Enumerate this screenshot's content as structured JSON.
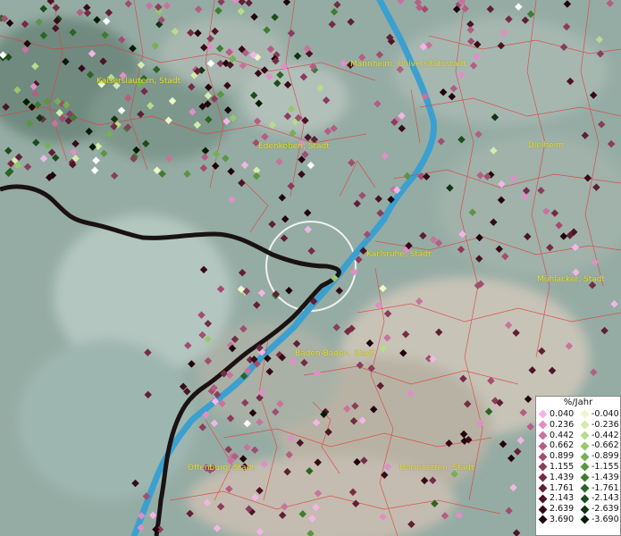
{
  "cities": [
    {
      "name": "Kaiserslautern, Stadt"
    },
    {
      "name": "Mannheim, Universitätsstadt"
    },
    {
      "name": "Edenkoben, Stadt"
    },
    {
      "name": "Dielheim"
    },
    {
      "name": "Karlsruhe, Stadt"
    },
    {
      "name": "Mühlacker, Stadt"
    },
    {
      "name": "Baden-Baden, Stadt"
    },
    {
      "name": "Offenburg, Stadt"
    },
    {
      "name": "Dornstetten, Stadt"
    }
  ],
  "legend": {
    "title": "%/Jahr",
    "positive": [
      {
        "label": "0.040",
        "color": "#f2b6e6"
      },
      {
        "label": "0.236",
        "color": "#e08ec8"
      },
      {
        "label": "0.442",
        "color": "#c8739e"
      },
      {
        "label": "0.662",
        "color": "#b45e84"
      },
      {
        "label": "0.899",
        "color": "#a04e70"
      },
      {
        "label": "1.155",
        "color": "#8a3d5b"
      },
      {
        "label": "1.439",
        "color": "#742c45"
      },
      {
        "label": "1.761",
        "color": "#601f34"
      },
      {
        "label": "2.143",
        "color": "#4c1424"
      },
      {
        "label": "2.639",
        "color": "#380a17"
      },
      {
        "label": "3.690",
        "color": "#22040c"
      }
    ],
    "negative": [
      {
        "label": "-0.040",
        "color": "#eef7c8"
      },
      {
        "label": "-0.236",
        "color": "#d4ecaa"
      },
      {
        "label": "-0.442",
        "color": "#b6dc8c"
      },
      {
        "label": "-0.662",
        "color": "#96c86e"
      },
      {
        "label": "-0.899",
        "color": "#76b055"
      },
      {
        "label": "-1.155",
        "color": "#5a9640"
      },
      {
        "label": "-1.439",
        "color": "#3f7c30"
      },
      {
        "label": "-1.761",
        "color": "#2b6424"
      },
      {
        "label": "-2.143",
        "color": "#1c4c1a"
      },
      {
        "label": "-2.639",
        "color": "#103610"
      },
      {
        "label": "-3.690",
        "color": "#061c06"
      }
    ]
  },
  "colors": {
    "river": "#3ba0d0",
    "border": "#1a1212",
    "boundaries": "#e04040",
    "city_label": "#e8e23a"
  }
}
